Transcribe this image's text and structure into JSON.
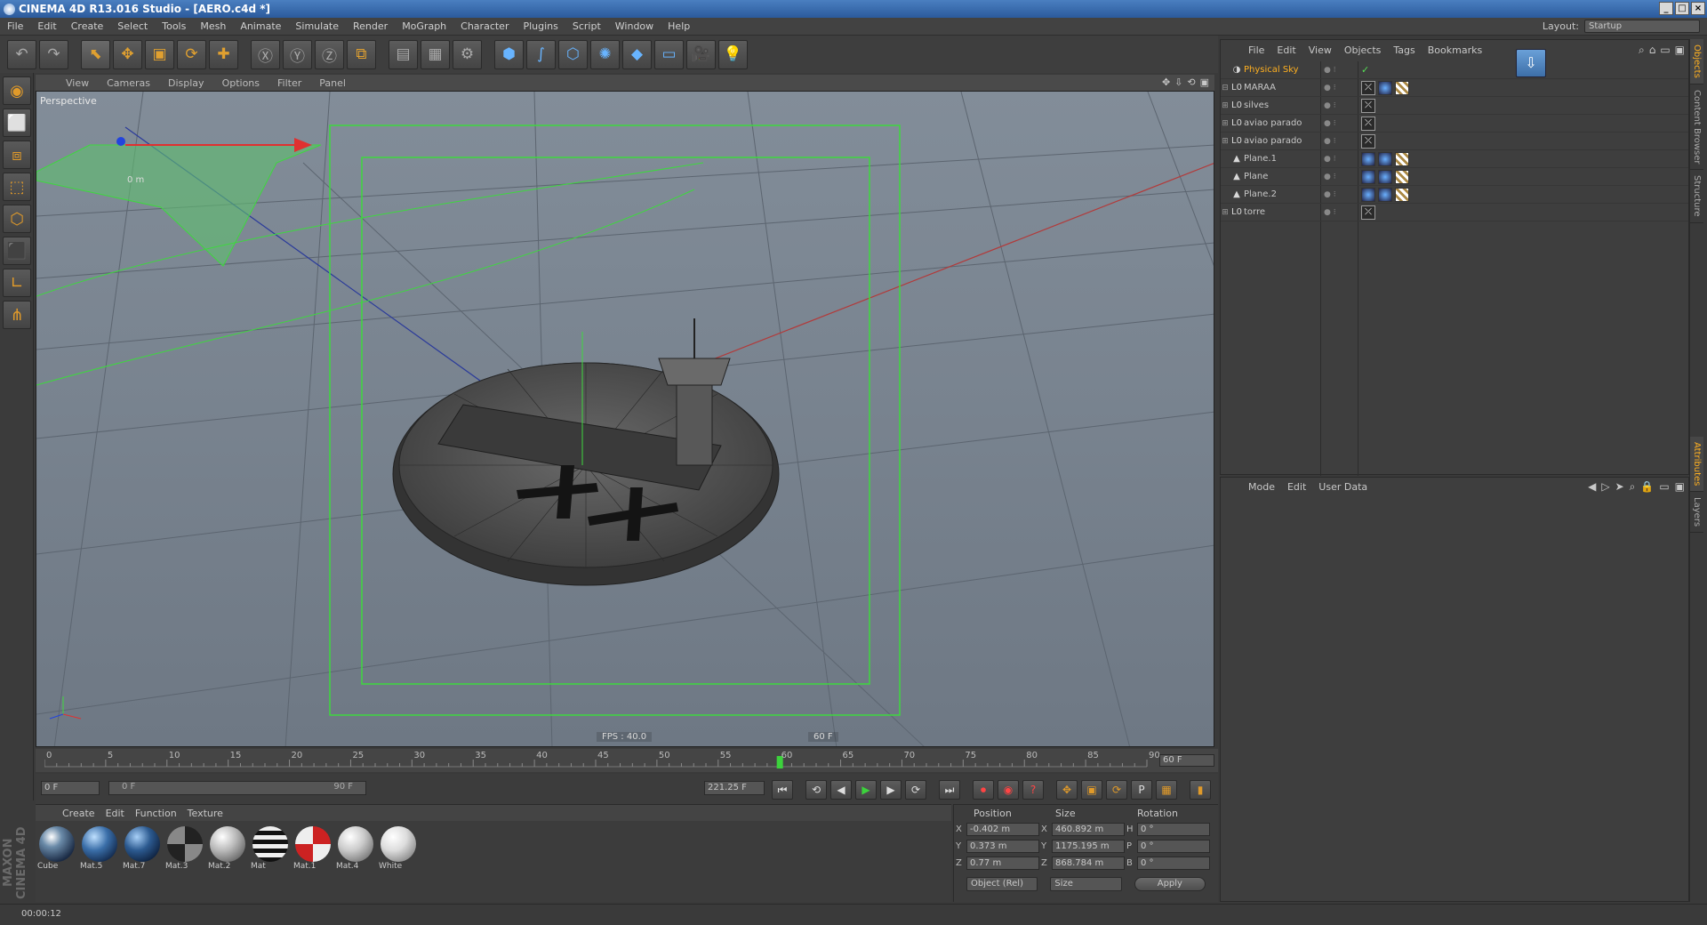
{
  "window": {
    "title": "CINEMA 4D R13.016 Studio - [AERO.c4d *]",
    "buttons": [
      "_",
      "□",
      "×"
    ]
  },
  "menubar": {
    "items": [
      "File",
      "Edit",
      "Create",
      "Select",
      "Tools",
      "Mesh",
      "Animate",
      "Simulate",
      "Render",
      "MoGraph",
      "Character",
      "Plugins",
      "Script",
      "Window",
      "Help"
    ],
    "layout_label": "Layout:",
    "layout_value": "Startup"
  },
  "toolbar": {
    "icons": [
      "undo-icon",
      "redo-icon",
      "live-selection-icon",
      "move-icon",
      "scale-icon",
      "rotate-icon",
      "recent-tools-icon",
      "x-axis-icon",
      "y-axis-icon",
      "z-axis-icon",
      "coordinate-system-icon",
      "render-view-icon",
      "render-picture-viewer-icon",
      "edit-render-settings-icon",
      "cube-icon",
      "spline-pen-icon",
      "subdivision-surface-icon",
      "array-icon",
      "deformer-icon",
      "floor-icon",
      "camera-icon",
      "light-icon"
    ],
    "glyphs": [
      "↶",
      "↷",
      "⬉",
      "✥",
      "▣",
      "⟳",
      "✚",
      "Ⓧ",
      "Ⓨ",
      "Ⓩ",
      "⧉",
      "▤",
      "▦",
      "⚙",
      "⬢",
      "∫",
      "⬡",
      "✺",
      "◆",
      "▭",
      "🎥",
      "💡"
    ]
  },
  "left_tools": {
    "icons": [
      "use-model-mode-icon",
      "make-editable-icon",
      "texture-mode-icon",
      "points-mode-icon",
      "edges-mode-icon",
      "polygons-mode-icon",
      "axis-mode-icon",
      "snap-icon"
    ],
    "glyphs": [
      "◉",
      "⬜",
      "⧈",
      "⬚",
      "⬡",
      "⬛",
      "∟",
      "⋔"
    ]
  },
  "viewport": {
    "menu": [
      "View",
      "Cameras",
      "Display",
      "Options",
      "Filter",
      "Panel"
    ],
    "label": "Perspective",
    "fps": "FPS : 40.0",
    "frame": "60 F",
    "distance_label": "0 m"
  },
  "timeline": {
    "ticks": [
      "0",
      "5",
      "10",
      "15",
      "20",
      "25",
      "30",
      "35",
      "40",
      "45",
      "50",
      "55",
      "60",
      "65",
      "70",
      "75",
      "80",
      "85",
      "90"
    ],
    "current": 60,
    "end_field": "60 F"
  },
  "transport": {
    "start_field": "0 F",
    "range_start": "0 F",
    "range_end": "90 F",
    "current_time": "221.25 F"
  },
  "material_manager": {
    "menu": [
      "Create",
      "Edit",
      "Function",
      "Texture"
    ],
    "materials": [
      {
        "name": "Cube",
        "style": "radial-gradient(circle at 35% 30%, #fff, #6a8aa8 30%, #1a2a44 75%)"
      },
      {
        "name": "Mat.5",
        "style": "radial-gradient(circle at 35% 30%, #bfe0ff, #3a6ea8 40%, #0d2040 85%)"
      },
      {
        "name": "Mat.7",
        "style": "radial-gradient(circle at 35% 30%, #a8d0f8, #2c5a90 40%, #0a1a34 85%)"
      },
      {
        "name": "Mat.3",
        "style": "conic-gradient(#222 0 25%, #888 0 50%, #222 0 75%, #888 0)"
      },
      {
        "name": "Mat.2",
        "style": "radial-gradient(circle at 35% 30%, #fff, #bbb 40%, #555 90%)"
      },
      {
        "name": "Mat",
        "style": "repeating-linear-gradient(0deg, #111 0 5px, #eee 5px 10px)"
      },
      {
        "name": "Mat.1",
        "style": "conic-gradient(#c22 0 25%, #eee 0 50%, #c22 0 75%, #eee 0)"
      },
      {
        "name": "Mat.4",
        "style": "radial-gradient(circle at 35% 30%, #fff, #ccc 40%, #666 90%)"
      },
      {
        "name": "White",
        "style": "radial-gradient(circle at 35% 30%, #fff, #ddd 40%, #777 90%)"
      }
    ]
  },
  "logo": "MAXON CINEMA 4D",
  "coordinates": {
    "headers": {
      "position": "Position",
      "size": "Size",
      "rotation": "Rotation"
    },
    "rows": [
      {
        "axis": "X",
        "pos": "-0.402 m",
        "size_axis": "X",
        "size": "460.892 m",
        "rot_axis": "H",
        "rot": "0 °"
      },
      {
        "axis": "Y",
        "pos": "0.373 m",
        "size_axis": "Y",
        "size": "1175.195 m",
        "rot_axis": "P",
        "rot": "0 °"
      },
      {
        "axis": "Z",
        "pos": "0.77 m",
        "size_axis": "Z",
        "size": "868.784 m",
        "rot_axis": "B",
        "rot": "0 °"
      }
    ],
    "mode_dropdown": "Object (Rel)",
    "size_dropdown": "Size",
    "apply_label": "Apply"
  },
  "status": {
    "time": "00:00:12"
  },
  "object_manager": {
    "menu": [
      "File",
      "Edit",
      "View",
      "Objects",
      "Tags",
      "Bookmarks"
    ],
    "objects": [
      {
        "name": "Physical Sky",
        "icon": "◑",
        "expand": "",
        "tags": [
          "✓"
        ],
        "selected": true
      },
      {
        "name": "MARAA",
        "icon": "L0",
        "expand": "⊟",
        "tags": [
          "phong",
          "tex",
          "chk"
        ]
      },
      {
        "name": "silves",
        "icon": "L0",
        "expand": "⊞",
        "tags": [
          "phong"
        ]
      },
      {
        "name": "aviao parado",
        "icon": "L0",
        "expand": "⊞",
        "tags": [
          "phong"
        ]
      },
      {
        "name": "aviao parado",
        "icon": "L0",
        "expand": "⊞",
        "tags": [
          "phong"
        ]
      },
      {
        "name": "Plane.1",
        "icon": "▲",
        "expand": "",
        "tags": [
          "tex",
          "tex",
          "chk"
        ]
      },
      {
        "name": "Plane",
        "icon": "▲",
        "expand": "",
        "tags": [
          "tex",
          "tex",
          "chk"
        ]
      },
      {
        "name": "Plane.2",
        "icon": "▲",
        "expand": "",
        "tags": [
          "tex",
          "tex",
          "chk"
        ]
      },
      {
        "name": "torre",
        "icon": "L0",
        "expand": "⊞",
        "tags": [
          "phong"
        ]
      }
    ]
  },
  "attribute_manager": {
    "menu": [
      "Mode",
      "Edit",
      "User Data"
    ]
  },
  "side_tabs_top": [
    "Objects",
    "Content Browser",
    "Structure"
  ],
  "side_tabs_bottom": [
    "Attributes",
    "Layers"
  ]
}
